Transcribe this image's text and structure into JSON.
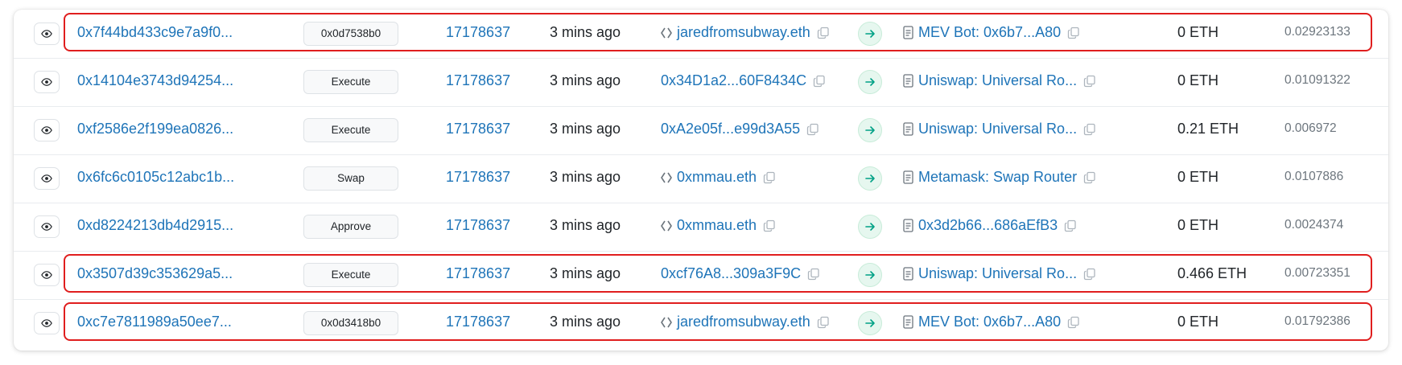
{
  "colors": {
    "link": "#1e74b8",
    "highlight": "#e01e1e",
    "arrow_bg": "#e6f7ef",
    "arrow_fg": "#00a186"
  },
  "rows": [
    {
      "hash": "0x7f44bd433c9e7a9f0...",
      "method": "0x0d7538b0",
      "block": "17178637",
      "age": "3 mins ago",
      "from": "jaredfromsubway.eth",
      "from_is_ens": true,
      "to": "MEV Bot: 0x6b7...A80",
      "value": "0 ETH",
      "fee": "0.02923133",
      "highlighted": true
    },
    {
      "hash": "0x14104e3743d94254...",
      "method": "Execute",
      "block": "17178637",
      "age": "3 mins ago",
      "from": "0x34D1a2...60F8434C",
      "from_is_ens": false,
      "to": "Uniswap: Universal Ro...",
      "value": "0 ETH",
      "fee": "0.01091322",
      "highlighted": false
    },
    {
      "hash": "0xf2586e2f199ea0826...",
      "method": "Execute",
      "block": "17178637",
      "age": "3 mins ago",
      "from": "0xA2e05f...e99d3A55",
      "from_is_ens": false,
      "to": "Uniswap: Universal Ro...",
      "value": "0.21 ETH",
      "fee": "0.006972",
      "highlighted": false
    },
    {
      "hash": "0x6fc6c0105c12abc1b...",
      "method": "Swap",
      "block": "17178637",
      "age": "3 mins ago",
      "from": "0xmmau.eth",
      "from_is_ens": true,
      "to": "Metamask: Swap Router",
      "value": "0 ETH",
      "fee": "0.0107886",
      "highlighted": false
    },
    {
      "hash": "0xd8224213db4d2915...",
      "method": "Approve",
      "block": "17178637",
      "age": "3 mins ago",
      "from": "0xmmau.eth",
      "from_is_ens": true,
      "to": "0x3d2b66...686aEfB3",
      "value": "0 ETH",
      "fee": "0.0024374",
      "highlighted": false
    },
    {
      "hash": "0x3507d39c353629a5...",
      "method": "Execute",
      "block": "17178637",
      "age": "3 mins ago",
      "from": "0xcf76A8...309a3F9C",
      "from_is_ens": false,
      "to": "Uniswap: Universal Ro...",
      "value": "0.466 ETH",
      "fee": "0.00723351",
      "highlighted": true
    },
    {
      "hash": "0xc7e7811989a50ee7...",
      "method": "0x0d3418b0",
      "block": "17178637",
      "age": "3 mins ago",
      "from": "jaredfromsubway.eth",
      "from_is_ens": true,
      "to": "MEV Bot: 0x6b7...A80",
      "value": "0 ETH",
      "fee": "0.01792386",
      "highlighted": true
    }
  ]
}
